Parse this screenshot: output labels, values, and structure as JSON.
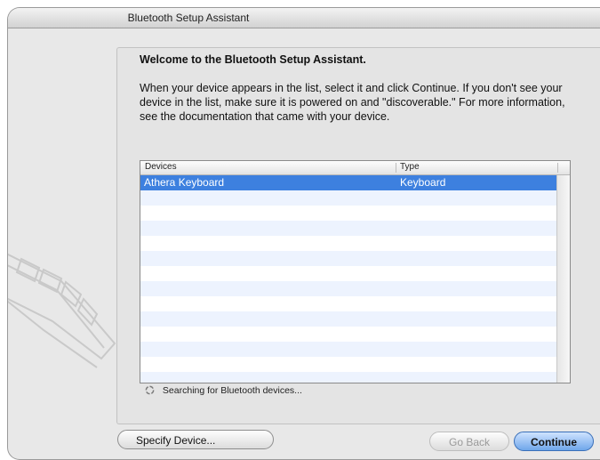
{
  "window": {
    "title": "Bluetooth Setup Assistant"
  },
  "main": {
    "heading": "Welcome to the Bluetooth Setup Assistant.",
    "description": "When your device appears in the list, select it and click Continue. If you don't see your device in the list, make sure it is powered on and \"discoverable.\" For more information, see the documentation that came with your device."
  },
  "device_list": {
    "columns": [
      "Devices",
      "Type"
    ],
    "rows": [
      {
        "name": "Athera Keyboard",
        "type": "Keyboard",
        "selected": true
      }
    ]
  },
  "status": {
    "text": "Searching for Bluetooth devices...",
    "icon": "spinner-icon"
  },
  "buttons": {
    "specify_device": "Specify Device...",
    "go_back": "Go Back",
    "continue": "Continue"
  },
  "colors": {
    "selection": "#3d80df",
    "alt_row": "#edf3fe"
  }
}
